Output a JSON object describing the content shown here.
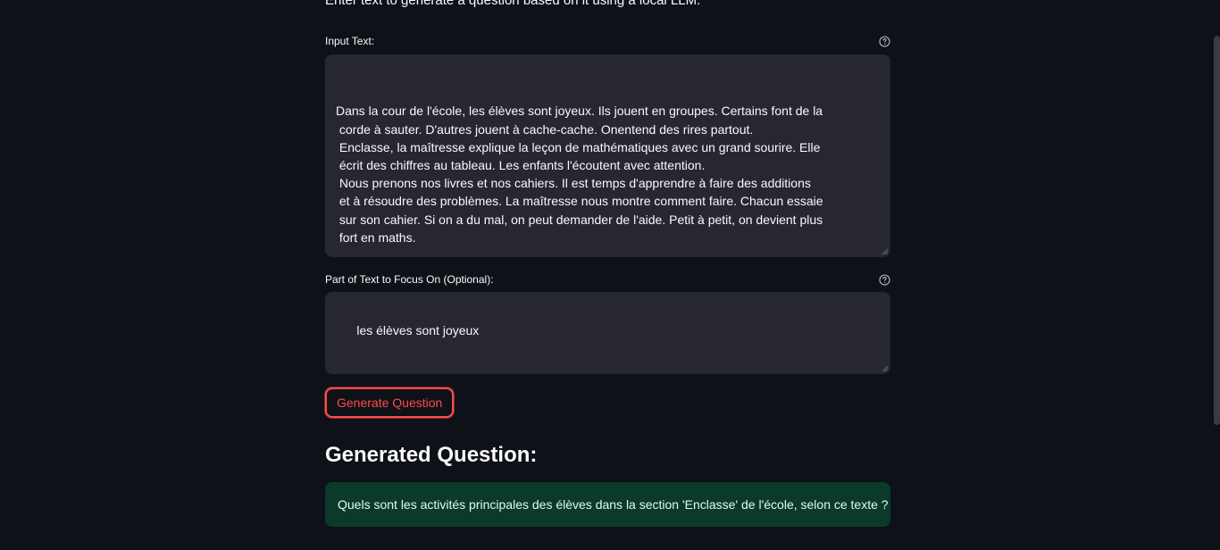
{
  "intro_text": "Enter text to generate a question based on it using a local LLM.",
  "input_text": {
    "label": "Input Text:",
    "lines": [
      "Dans la cour de l'école, les élèves sont joyeux. Ils jouent en groupes. Certains font de la",
      " corde à sauter. D'autres jouent à cache-cache. Onentend des rires partout.",
      " Enclasse, la maîtresse explique la leçon de mathématiques avec un grand sourire. Elle",
      " écrit des chiffres au tableau. Les enfants l'écoutent avec attention.",
      " Nous prenons nos livres et nos cahiers. Il est temps d'apprendre à faire des additions",
      " et à résoudre des problèmes. La maîtresse nous montre comment faire. Chacun essaie",
      " sur son cahier. Si on a du mal, on peut demander de l'aide. Petit à petit, on devient plus",
      " fort en maths."
    ]
  },
  "focus_text": {
    "label": "Part of Text to Focus On (Optional):",
    "value": "les élèves sont joyeux"
  },
  "generate_button": {
    "label": "Generate Question"
  },
  "result": {
    "heading": "Generated Question:",
    "question": "Quels sont les activités principales des élèves dans la section 'Enclasse' de l'école, selon ce texte ?"
  },
  "colors": {
    "background": "#0e1117",
    "textarea_bg": "#262730",
    "accent": "#ff4b4b",
    "success_bg": "#0b3a2b",
    "success_text": "#dffde9"
  }
}
